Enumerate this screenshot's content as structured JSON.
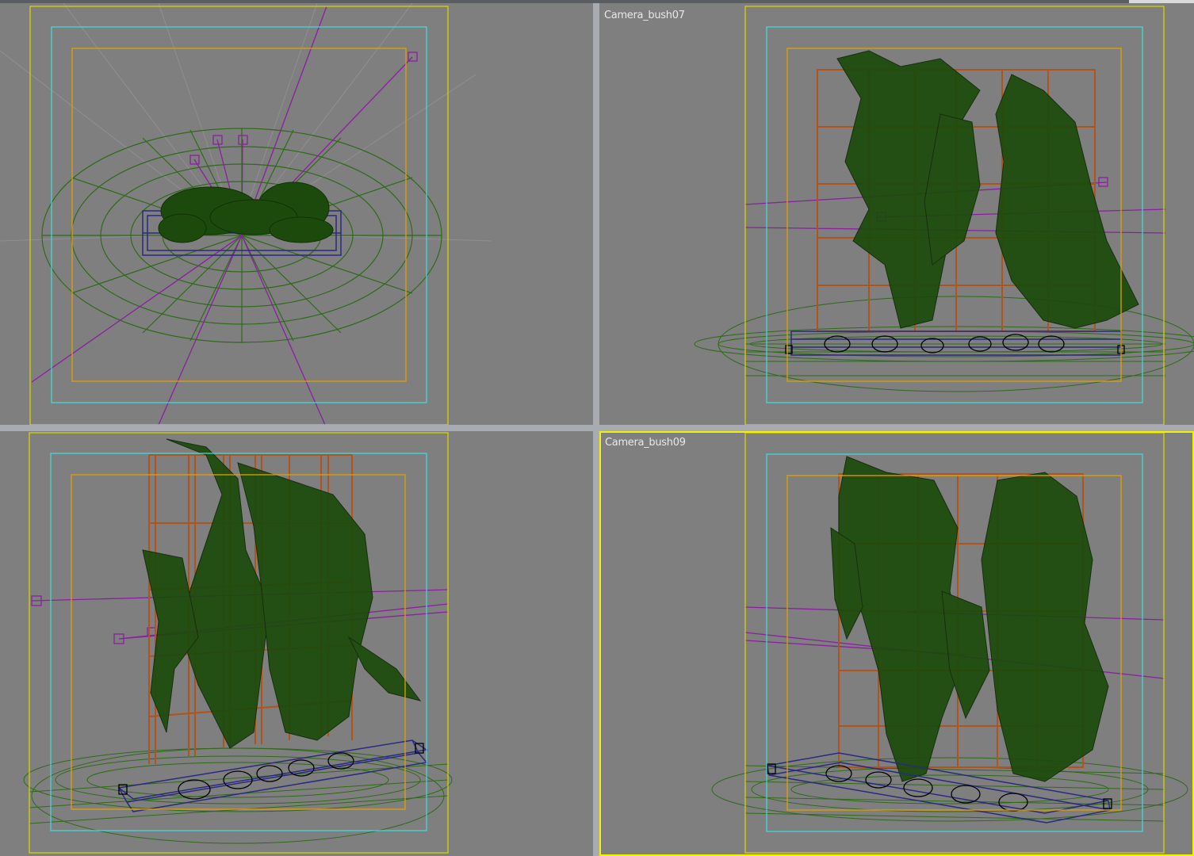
{
  "viewports": [
    {
      "id": "top-left",
      "label": "",
      "active": false
    },
    {
      "id": "top-right",
      "label": "Camera_bush07",
      "active": false
    },
    {
      "id": "bottom-left",
      "label": "",
      "active": false
    },
    {
      "id": "bottom-right",
      "label": "Camera_bush09",
      "active": true
    }
  ],
  "colors": {
    "viewport_bg": "#7f7f7f",
    "safe_frame_outer": "#d8d000",
    "safe_frame_action": "#40d8d8",
    "safe_frame_title": "#e0a000",
    "active_border": "#f3f300",
    "foliage": "#1c4a0c",
    "trellis": "#b0541c",
    "planter": "#2a2a80",
    "light": "#8a20a0",
    "ground_grid": "#2f6a1a"
  }
}
